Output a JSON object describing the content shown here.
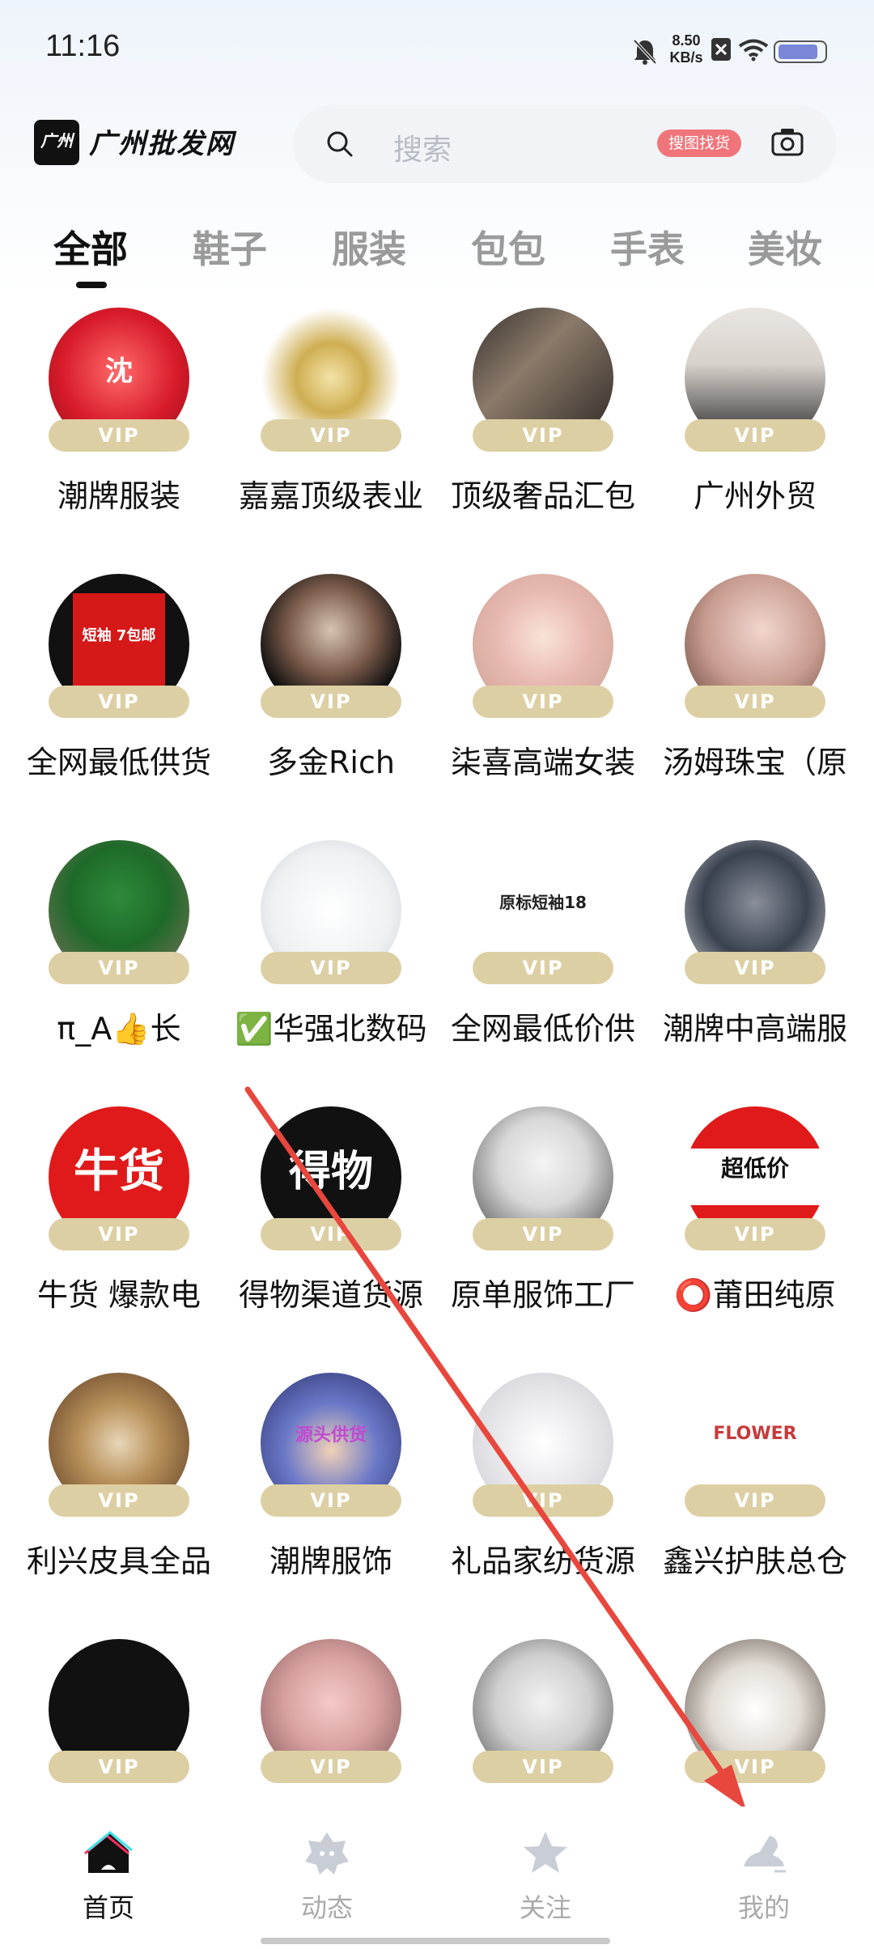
{
  "status_bar": {
    "time": "11:16",
    "net_speed_value": "8.50",
    "net_speed_unit": "KB/s",
    "icons": [
      "bell-mute-icon",
      "data-off-icon",
      "wifi-icon",
      "battery-icon"
    ],
    "battery_level": 0.85
  },
  "header": {
    "logo_text": "广州批发网",
    "logo_badge": "广州",
    "search_placeholder": "搜索",
    "search_tag": "搜图找货"
  },
  "tabs": [
    {
      "label": "全部",
      "active": true
    },
    {
      "label": "鞋子",
      "active": false
    },
    {
      "label": "服装",
      "active": false
    },
    {
      "label": "包包",
      "active": false
    },
    {
      "label": "手表",
      "active": false
    },
    {
      "label": "美妆",
      "active": false
    }
  ],
  "vip_label": "VIP",
  "shops": [
    {
      "name": "潮牌服装",
      "avatar_text": "沈"
    },
    {
      "name": "嘉嘉顶级表业",
      "avatar_text": ""
    },
    {
      "name": "顶级奢品汇包",
      "avatar_text": ""
    },
    {
      "name": "广州外贸",
      "avatar_text": ""
    },
    {
      "name": "全网最低供货",
      "avatar_text": "短袖 7包邮"
    },
    {
      "name": "多金Rich",
      "avatar_text": ""
    },
    {
      "name": "柒喜高端女装",
      "avatar_text": ""
    },
    {
      "name": "汤姆珠宝（原",
      "avatar_text": ""
    },
    {
      "name": "π_A👍长",
      "avatar_text": ""
    },
    {
      "name": "✅华强北数码",
      "avatar_text": ""
    },
    {
      "name": "全网最低价供",
      "avatar_text": "原标短袖18"
    },
    {
      "name": "潮牌中高端服",
      "avatar_text": ""
    },
    {
      "name": "牛货 爆款电",
      "avatar_text": "牛货"
    },
    {
      "name": "得物渠道货源",
      "avatar_text": "得物"
    },
    {
      "name": "原单服饰工厂",
      "avatar_text": ""
    },
    {
      "name": "⭕莆田纯原",
      "avatar_text": "超低价"
    },
    {
      "name": "利兴皮具全品",
      "avatar_text": ""
    },
    {
      "name": "潮牌服饰",
      "avatar_text": "源头供货"
    },
    {
      "name": "礼品家纺货源",
      "avatar_text": ""
    },
    {
      "name": "鑫兴护肤总仓",
      "avatar_text": "FLOWER"
    },
    {
      "name": "",
      "avatar_text": ""
    },
    {
      "name": "",
      "avatar_text": ""
    },
    {
      "name": "",
      "avatar_text": ""
    },
    {
      "name": "",
      "avatar_text": ""
    }
  ],
  "bottom_nav": [
    {
      "label": "首页",
      "icon": "home-icon",
      "active": true
    },
    {
      "label": "动态",
      "icon": "moments-icon",
      "active": false
    },
    {
      "label": "关注",
      "icon": "star-icon",
      "active": false
    },
    {
      "label": "我的",
      "icon": "profile-icon",
      "active": false
    }
  ],
  "colors": {
    "vip_badge": "#ddcfa4",
    "search_tag": "#f0757a",
    "annotation_arrow": "#e8473d",
    "active_text": "#111111",
    "inactive_text": "#9a9a9a"
  }
}
